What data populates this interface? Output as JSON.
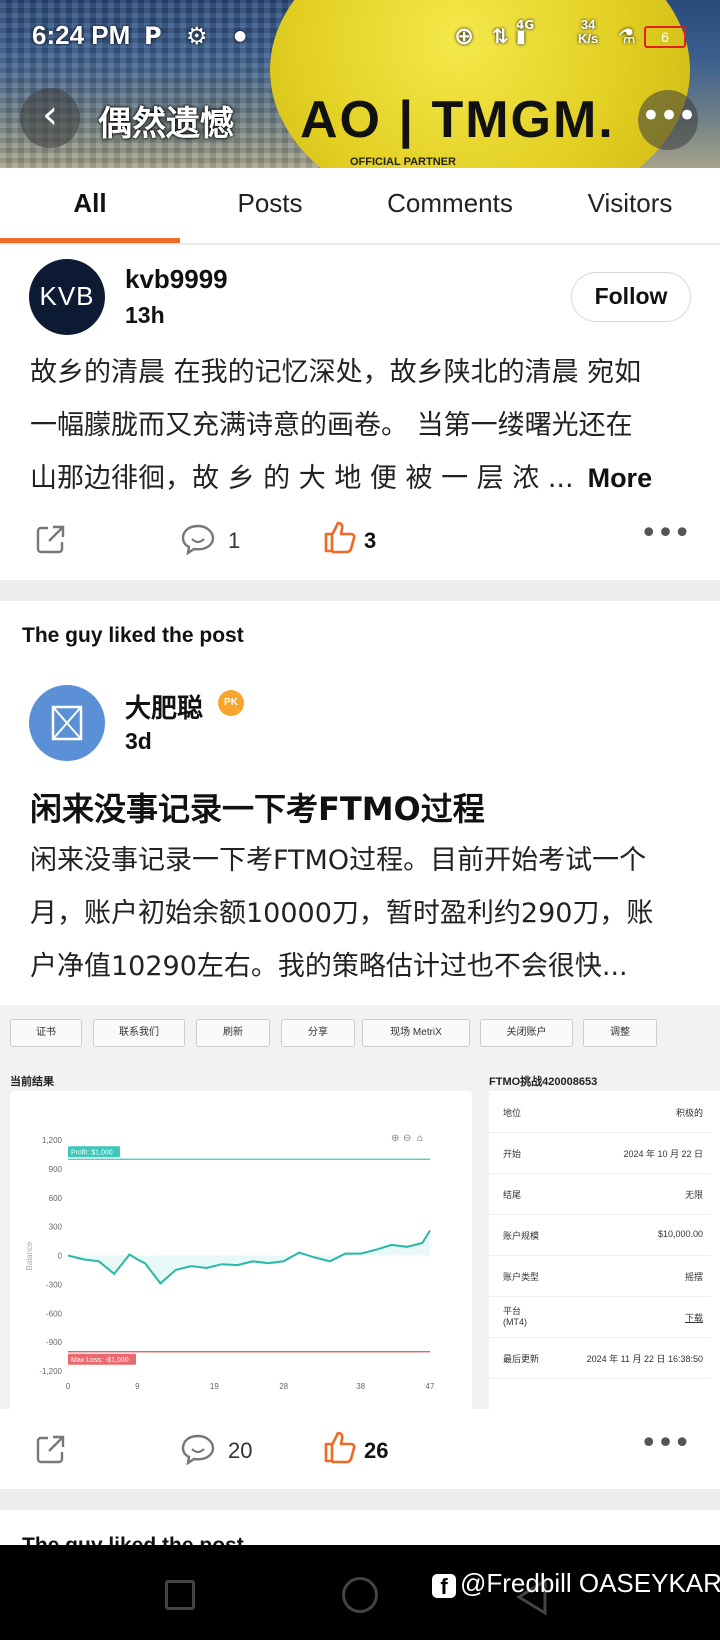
{
  "status_bar": {
    "time": "6:24 PM",
    "net_type": "4G",
    "net_speed_value": "34",
    "net_speed_unit": "K/s",
    "battery": "6"
  },
  "header": {
    "title": "偶然遗憾",
    "banner_brand": "AO | TMGM.",
    "banner_sub": "OFFICIAL PARTNER"
  },
  "tabs": [
    {
      "label": "All",
      "active": true
    },
    {
      "label": "Posts"
    },
    {
      "label": "Comments"
    },
    {
      "label": "Visitors"
    }
  ],
  "feed": [
    {
      "avatar_text": "KVB",
      "username": "kvb9999",
      "time_ago": "13h",
      "follow_label": "Follow",
      "lines": [
        "故乡的清晨 在我的记忆深处，故乡陕北的清晨 宛如",
        "一幅朦胧而又充满诗意的画卷。 当第一缕曙光还在",
        "山那边徘徊，故 乡 的 大 地 便 被 一 层 浓 ..."
      ],
      "more_label": "More",
      "comments": "1",
      "likes": "3"
    },
    {
      "liked_note": "The guy liked the post",
      "username": "大肥聪",
      "badge": "PK",
      "time_ago": "3d",
      "title": "闲来没事记录一下考FTMO过程",
      "lines": [
        "闲来没事记录一下考FTMO过程。目前开始考试一个",
        "月，账户初始余额10000刀，暂时盈利约290刀，账",
        "户净值10290左右。我的策略估计过也不会很快..."
      ],
      "comments": "20",
      "likes": "26"
    }
  ],
  "screenshot": {
    "toolbar": [
      "证书",
      "联系我们",
      "刷新",
      "分享",
      "现场 MetriX",
      "关闭账户",
      "调整"
    ],
    "left_title": "当前结果",
    "right_title": "FTMO挑战420008653",
    "info_rows": [
      {
        "k": "地位",
        "v": "积极的"
      },
      {
        "k": "开始",
        "v": "2024 年 10 月 22 日"
      },
      {
        "k": "结尾",
        "v": "无限"
      },
      {
        "k": "账户规模",
        "v": "$10,000.00"
      },
      {
        "k": "账户类型",
        "v": "摇摆"
      },
      {
        "k": "平台",
        "k2": "(MT4)",
        "v": "下载"
      },
      {
        "k": "最后更新",
        "v": "2024 年 11 月 22 日 16:38:50"
      }
    ]
  },
  "chart_data": {
    "type": "line",
    "ylabel": "Balance",
    "ylim": [
      -1200,
      1200
    ],
    "yticks": [
      "1,200",
      "900",
      "600",
      "300",
      "0",
      "-300",
      "-600",
      "-900",
      "-1,200"
    ],
    "xticks": [
      "0",
      "9",
      "19",
      "28",
      "38",
      "47"
    ],
    "profit_line": {
      "label": "Profit: $1,000",
      "value": 1000
    },
    "loss_line": {
      "label": "Max Loss: -$1,000",
      "value": -1000
    },
    "x": [
      0,
      2,
      4,
      6,
      8,
      9,
      10,
      12,
      14,
      16,
      18,
      20,
      22,
      24,
      26,
      28,
      30,
      32,
      34,
      36,
      38,
      40,
      42,
      44,
      46,
      47
    ],
    "values": [
      0,
      -40,
      -60,
      -190,
      10,
      -40,
      -80,
      -290,
      -150,
      -110,
      -130,
      -90,
      -100,
      -60,
      -80,
      -60,
      30,
      -20,
      -60,
      20,
      20,
      60,
      110,
      90,
      130,
      260
    ]
  },
  "second_liked_note": "The guy liked the post",
  "watermark": "@Fredbill OASEYKAR"
}
